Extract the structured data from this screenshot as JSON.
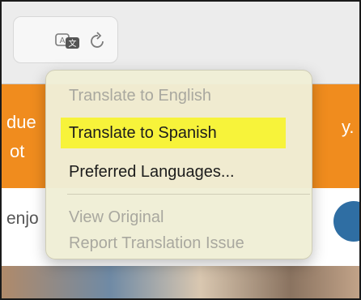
{
  "banner": {
    "left_fragment_1": "due",
    "left_fragment_2": "ot",
    "right_fragment": "y."
  },
  "content": {
    "left_fragment": "enjo"
  },
  "toolbar": {
    "translate_icon": "translate-icon",
    "reload_icon": "reload-icon"
  },
  "menu": {
    "items": [
      {
        "label": "Translate to English",
        "enabled": false
      },
      {
        "label": "Translate to Spanish",
        "enabled": true,
        "highlighted": true
      },
      {
        "label": "Preferred Languages...",
        "enabled": true
      },
      {
        "label": "View Original",
        "enabled": false
      },
      {
        "label": "Report Translation Issue",
        "enabled": false
      }
    ]
  },
  "colors": {
    "banner": "#f08c1e",
    "menu_bg": "#f0eed6",
    "highlight": "#f7f33a",
    "disabled_text": "#a9a89f"
  }
}
